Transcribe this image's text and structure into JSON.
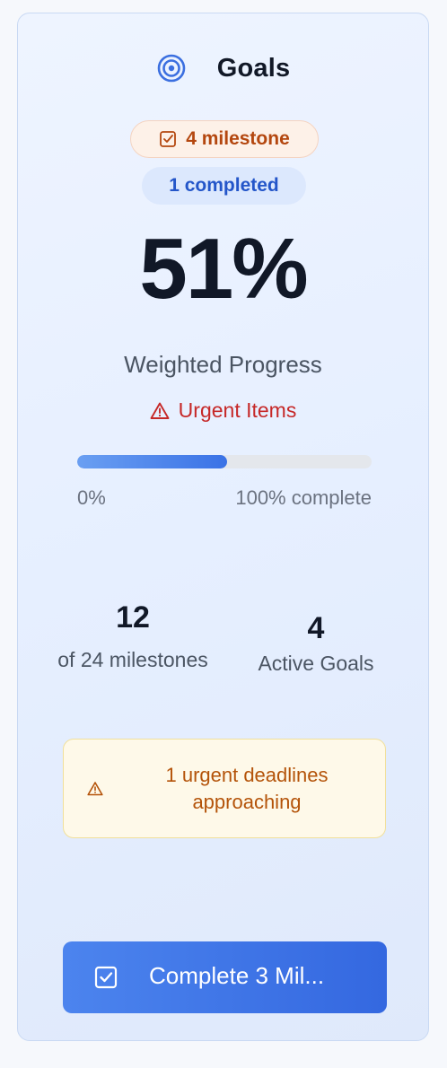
{
  "header": {
    "title": "Goals",
    "icon": "target-icon",
    "accent": "#3b6fe0"
  },
  "badges": {
    "milestone": {
      "label": "4 milestone",
      "icon": "checkbox-icon"
    },
    "completed": {
      "label": "1 completed"
    }
  },
  "progress": {
    "percent_label": "51%",
    "subtitle": "Weighted Progress",
    "urgent_label": "Urgent Items",
    "urgent_icon": "warning-icon",
    "bar_fraction": 0.51,
    "scale_min": "0%",
    "scale_max": "100% complete"
  },
  "stats": {
    "milestones": {
      "value": "12",
      "label": "of 24 milestones"
    },
    "goals": {
      "value": "4",
      "label": "Active Goals"
    }
  },
  "alert": {
    "text": "1 urgent deadlines approaching",
    "icon": "warning-icon"
  },
  "action": {
    "label": "Complete 3 Mil...",
    "icon": "checkbox-icon"
  },
  "colors": {
    "urgent": "#c62828",
    "milestone_badge": "#b4470f",
    "completed_badge": "#2456c9",
    "alert_text": "#b45309",
    "button": "#3b6fe0"
  }
}
